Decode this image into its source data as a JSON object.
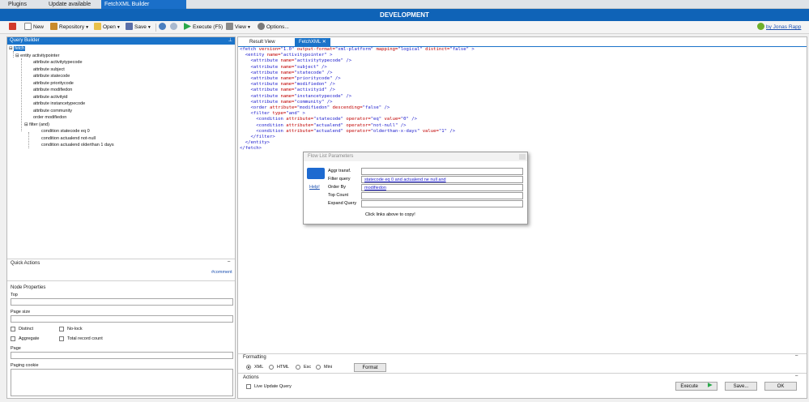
{
  "top_tabs": [
    "Plugins",
    "Update available",
    "FetchXML Builder"
  ],
  "title": "DEVELOPMENT",
  "toolbar": {
    "new": "New",
    "repository": "Repository",
    "open": "Open",
    "save": "Save",
    "execute": "Execute (F5)",
    "view": "View",
    "options": "Options...",
    "by": "by Jonas Rapp"
  },
  "left": {
    "header": "Query Builder",
    "tree": {
      "root": "fetch",
      "entity": "entity activitypointer",
      "attributes": [
        "attribute activitytypecode",
        "attribute subject",
        "attribute statecode",
        "attribute prioritycode",
        "attribute modifiedon",
        "attribute activityid",
        "attribute instancetypecode",
        "attribute community"
      ],
      "order": "order modifiedon",
      "filter": "filter (and)",
      "conditions": [
        "condition statecode eq 0",
        "condition actualend not-null",
        "condition actualend olderthan 1 days"
      ]
    },
    "quick_actions": "Quick Actions",
    "comment_link": "#comment",
    "node_properties": "Node Properties",
    "top_label": "Top",
    "page_size_label": "Page size",
    "distinct": "Distinct",
    "nolock": "No-lock",
    "aggregate": "Aggregate",
    "total_record_count": "Total record count",
    "page_label": "Page",
    "paging_cookie_label": "Paging cookie"
  },
  "right": {
    "tabs": [
      "Result View",
      "FetchXML"
    ],
    "formatting": "Formatting",
    "format_options": [
      "XML",
      "HTML",
      "Esc",
      "Mini"
    ],
    "format_button": "Format",
    "actions": "Actions",
    "live_update": "Live Update Query",
    "execute_button": "Execute",
    "save_button": "Save...",
    "ok_button": "OK"
  },
  "xml_lines": [
    "<fetch version=\"1.0\" output-format=\"xml-platform\" mapping=\"logical\" distinct=\"false\" >",
    "  <entity name=\"activitypointer\" >",
    "    <attribute name=\"activitytypecode\" />",
    "    <attribute name=\"subject\" />",
    "    <attribute name=\"statecode\" />",
    "    <attribute name=\"prioritycode\" />",
    "    <attribute name=\"modifiedon\" />",
    "    <attribute name=\"activityid\" />",
    "    <attribute name=\"instancetypecode\" />",
    "    <attribute name=\"community\" />",
    "    <order attribute=\"modifiedon\" descending=\"false\" />",
    "    <filter type=\"and\" >",
    "      <condition attribute=\"statecode\" operator=\"eq\" value=\"0\" />",
    "      <condition attribute=\"actualend\" operator=\"not-null\" />",
    "      <condition attribute=\"actualend\" operator=\"olderthan-x-days\" value=\"1\" />",
    "    </filter>",
    "  </entity>",
    "</fetch>"
  ],
  "dialog": {
    "title": "Flow List Parameters",
    "help": "Help!",
    "aggr_label": "Aggr transf.",
    "filter_label": "Filter query",
    "filter_value": "statecode eq 0 and actualend ne null and",
    "order_label": "Order By",
    "order_value": "modifiedon",
    "top_label": "Top Count",
    "expand_label": "Expand Query",
    "hint": "Click links above to copy!"
  },
  "colors": {
    "accent": "#1a73c9",
    "title_bar": "#0f63b7",
    "xml_attr": "#c00000",
    "xml_tag": "#1a1acc"
  }
}
